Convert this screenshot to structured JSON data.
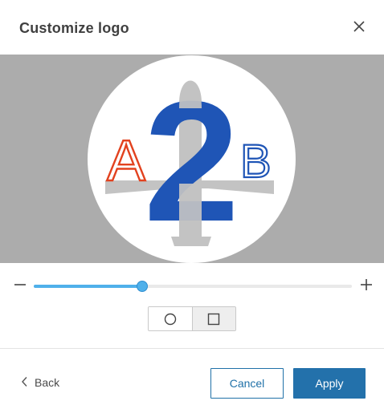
{
  "dialog": {
    "title": "Customize logo",
    "close_icon": "close-icon"
  },
  "logo": {
    "left_letter": "A",
    "center_numeral": "2",
    "right_letter": "B",
    "colors": {
      "letter_a": "#e2421f",
      "numeral": "#1f55b6",
      "letter_b": "#1f55b6",
      "plane": "#c3c3c3",
      "preview_background": "#acacac"
    }
  },
  "zoom": {
    "minus_icon": "minus-icon",
    "plus_icon": "plus-icon",
    "value_fraction": 0.34,
    "accent_color": "#4fb0ea"
  },
  "shape_toggle": {
    "options": [
      {
        "icon": "circle-icon",
        "selected": false
      },
      {
        "icon": "square-icon",
        "selected": true
      }
    ]
  },
  "footer": {
    "back_label": "Back",
    "back_icon": "chevron-left-icon",
    "cancel_label": "Cancel",
    "apply_label": "Apply",
    "primary_color": "#2371ab"
  }
}
